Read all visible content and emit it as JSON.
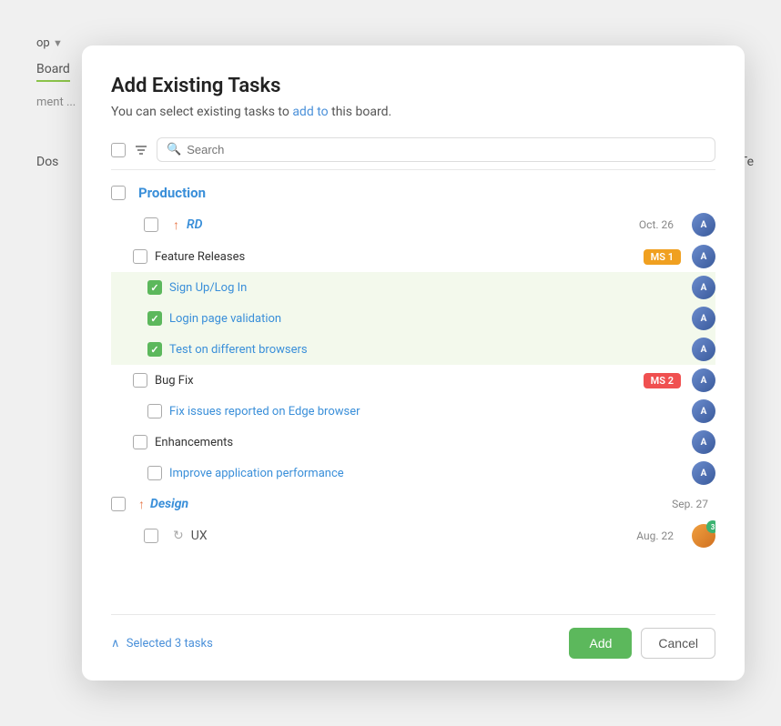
{
  "app": {
    "name": "op",
    "sidebar_items": [
      {
        "label": "Board"
      },
      {
        "label": "ment ..."
      },
      {
        "label": "Dos"
      },
      {
        "label": "Te"
      }
    ]
  },
  "modal": {
    "title": "Add Existing Tasks",
    "subtitle": "You can select existing tasks to add to this board.",
    "search_placeholder": "Search",
    "toolbar": {
      "filter_icon": "▼"
    },
    "sections": [
      {
        "name": "Production",
        "arrow": "↑",
        "date": "",
        "color": "blue",
        "subsections": [
          {
            "name": "RD",
            "arrow": "↑",
            "date": "Oct. 26",
            "tasks": [
              {
                "name": "Feature Releases",
                "milestone": "MS 1",
                "milestone_class": "ms1",
                "checked": false,
                "sub_tasks": [
                  {
                    "name": "Sign Up/Log In",
                    "checked": true
                  },
                  {
                    "name": "Login page validation",
                    "checked": true
                  },
                  {
                    "name": "Test on different browsers",
                    "checked": true
                  }
                ]
              },
              {
                "name": "Bug Fix",
                "milestone": "MS 2",
                "milestone_class": "ms2",
                "checked": false,
                "sub_tasks": [
                  {
                    "name": "Fix issues reported on Edge browser",
                    "checked": false
                  }
                ]
              },
              {
                "name": "Enhancements",
                "milestone": "",
                "checked": false,
                "sub_tasks": [
                  {
                    "name": "Improve application performance",
                    "checked": false
                  }
                ]
              }
            ]
          }
        ]
      },
      {
        "name": "Design",
        "arrow": "↑",
        "date": "Sep. 27",
        "subsections": [
          {
            "name": "UX",
            "arrow": "",
            "date": "Aug. 22",
            "tasks": []
          }
        ]
      }
    ],
    "selected_count": "Selected 3 tasks",
    "add_button": "Add",
    "cancel_button": "Cancel"
  }
}
